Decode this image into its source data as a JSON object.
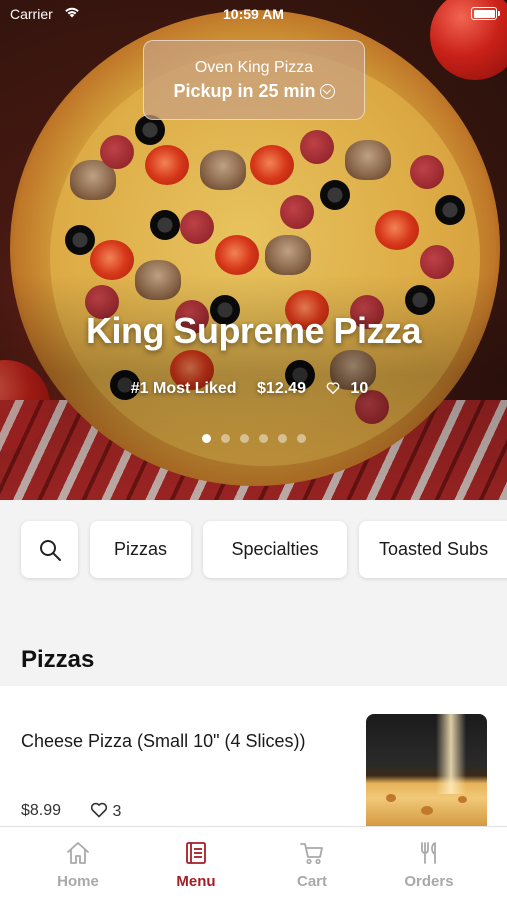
{
  "status_bar": {
    "carrier": "Carrier",
    "time": "10:59 AM"
  },
  "store": {
    "name": "Oven King Pizza",
    "pickup": "Pickup in 25 min"
  },
  "hero": {
    "title": "King Supreme Pizza",
    "tag": "#1 Most Liked",
    "price": "$12.49",
    "likes": "10",
    "slides": 6,
    "active_slide": 1
  },
  "categories": {
    "search_icon": "search-icon",
    "items": [
      "Pizzas",
      "Specialties",
      "Toasted Subs"
    ]
  },
  "section": {
    "title": "Pizzas",
    "items": [
      {
        "name": "Cheese Pizza (Small 10\" (4 Slices))",
        "price": "$8.99",
        "likes": "3"
      }
    ]
  },
  "tabbar": {
    "items": [
      {
        "label": "Home",
        "icon": "home-icon",
        "active": false
      },
      {
        "label": "Menu",
        "icon": "menu-icon",
        "active": true
      },
      {
        "label": "Cart",
        "icon": "cart-icon",
        "active": false
      },
      {
        "label": "Orders",
        "icon": "orders-icon",
        "active": false
      }
    ],
    "active_color": "#a61c25",
    "inactive_color": "#a9a9a9"
  }
}
